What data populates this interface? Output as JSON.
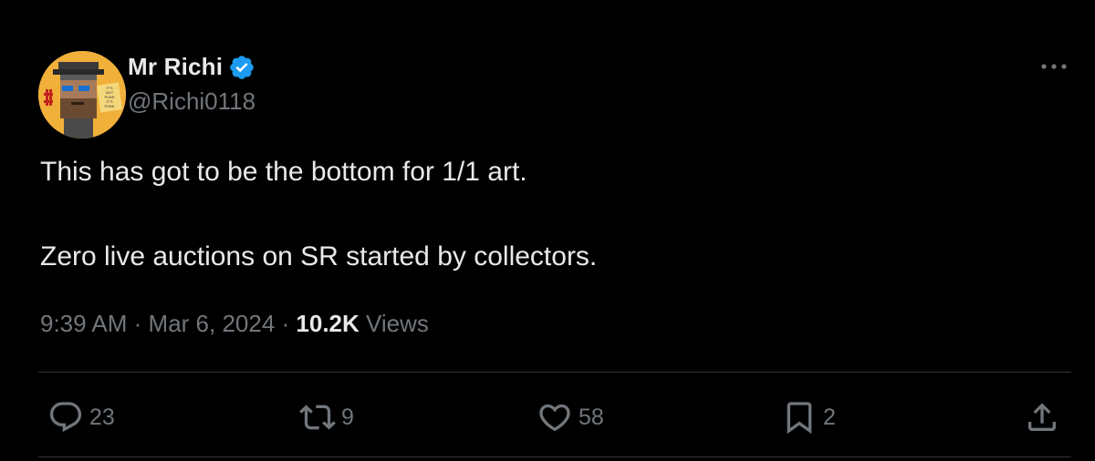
{
  "author": {
    "display_name": "Mr Richi",
    "handle": "@Richi0118",
    "verified": true,
    "avatar_icon": "pixel-art-avatar",
    "avatar_bg": "#f0b03a",
    "avatar_text": [
      "IT'S",
      "NOT",
      "PUNK",
      "IT'S",
      "PUNK"
    ]
  },
  "tweet": {
    "lines": [
      "This has got to be the bottom for 1/1 art.",
      "Zero live auctions on SR started by collectors."
    ],
    "time": "9:39 AM",
    "date": "Mar 6, 2024",
    "views_count": "10.2K",
    "views_label": "Views"
  },
  "actions": {
    "replies": "23",
    "reposts": "9",
    "likes": "58",
    "bookmarks": "2"
  },
  "colors": {
    "background": "#000000",
    "text": "#e7e9ea",
    "secondary": "#71767b",
    "verified": "#1d9bf0",
    "divider": "#2f3336"
  }
}
